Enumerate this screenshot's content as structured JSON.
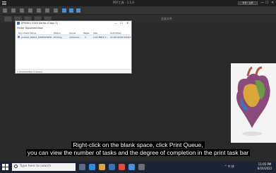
{
  "app": {
    "title": "PDF工具 - 1.1.0",
    "login_label": "登录 / 注册",
    "min_glyph": "—",
    "max_glyph": "☐",
    "close_glyph": "✕",
    "strip_label": "全部文件"
  },
  "dialog": {
    "title": "EPSON L3150 Series (Copy 1)",
    "menu": [
      "Printer",
      "Document",
      "View"
    ],
    "columns": [
      "Document Name",
      "Status",
      "Owner",
      "Pages",
      "Size",
      "Submitted"
    ],
    "rows": [
      {
        "name": "portrait_00001_1803567658...",
        "status": "Printing",
        "owner": "administr...",
        "pages": "1",
        "size": "2.04 MB/3.1...",
        "submitted": "11:05:00 PM 6/16/2..."
      }
    ],
    "status_text": "1 document(s) in queue",
    "min_glyph": "—",
    "max_glyph": "☐",
    "close_glyph": "✕"
  },
  "subtitle": {
    "line1": "Right-click on the blank space, click Print Queue,",
    "line2": "you can view the number of tasks and the degree of completion in the print task bar"
  },
  "taskbar": {
    "search_placeholder": "Type here to search",
    "tray_text": "^ 中 拼",
    "time": "11:05 PM",
    "date": "6/16/2022"
  }
}
